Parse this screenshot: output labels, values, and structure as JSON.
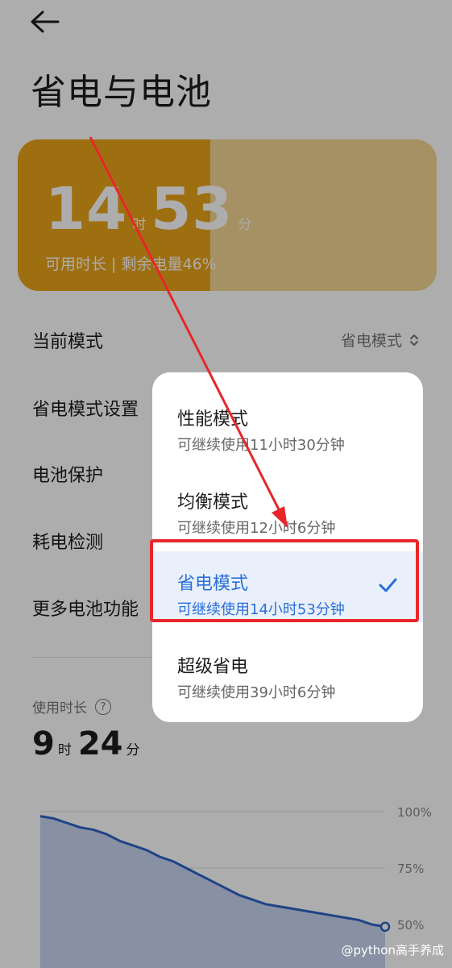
{
  "header": {
    "title": "省电与电池"
  },
  "battery": {
    "hours": "14",
    "hours_unit": "时",
    "minutes": "53",
    "minutes_unit": "分",
    "subtitle": "可用时长 | 剩余电量46%",
    "level_percent": 46
  },
  "settings": {
    "current_mode_label": "当前模式",
    "current_mode_value": "省电模式",
    "items": [
      "省电模式设置",
      "电池保护",
      "耗电检测",
      "更多电池功能"
    ]
  },
  "usage": {
    "label": "使用时长",
    "hours": "9",
    "hours_unit": "时",
    "minutes": "24",
    "minutes_unit": "分"
  },
  "chart_data": {
    "type": "area",
    "y_ticks": [
      "100%",
      "75%",
      "50%"
    ],
    "ylim": [
      50,
      100
    ],
    "values": [
      98,
      97,
      95,
      93,
      92,
      90,
      87,
      85,
      83,
      80,
      78,
      75,
      72,
      69,
      66,
      63,
      61,
      59,
      58,
      57,
      56,
      55,
      54,
      53,
      52,
      50,
      49
    ],
    "colors": {
      "line": "#2f63c6",
      "fill": "#c7d6f1"
    }
  },
  "mode_menu": {
    "options": [
      {
        "name": "性能模式",
        "desc": "可继续使用11小时30分钟",
        "selected": false
      },
      {
        "name": "均衡模式",
        "desc": "可继续使用12小时6分钟",
        "selected": false
      },
      {
        "name": "省电模式",
        "desc": "可继续使用14小时53分钟",
        "selected": true
      },
      {
        "name": "超级省电",
        "desc": "可继续使用39小时6分钟",
        "selected": false
      }
    ]
  },
  "watermark": "@python高手养成",
  "colors": {
    "accent": "#2a6fd9",
    "battery_fill": "#e9a41a",
    "annotation_red": "#e8262a"
  }
}
